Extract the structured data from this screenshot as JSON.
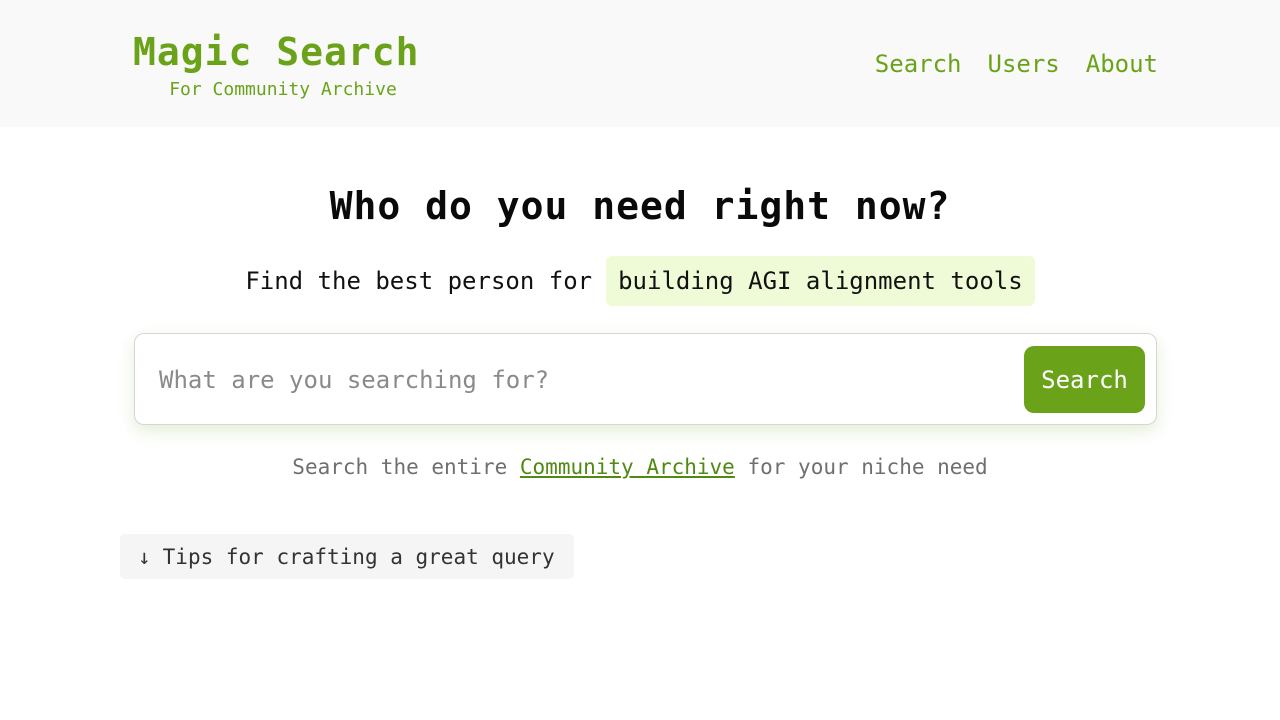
{
  "header": {
    "title": "Magic Search",
    "subtitle": "For Community Archive",
    "nav": [
      {
        "label": "Search"
      },
      {
        "label": "Users"
      },
      {
        "label": "About"
      }
    ]
  },
  "main": {
    "headline": "Who do you need right now?",
    "find_label": "Find the best person for",
    "find_topic": "building AGI alignment tools",
    "search": {
      "placeholder": "What are you searching for?",
      "value": "",
      "button_label": "Search"
    },
    "helper": {
      "prefix": "Search the entire",
      "link": "Community Archive",
      "suffix": "for your niche need"
    },
    "tips": {
      "icon": "arrow-down-icon",
      "label": "Tips for crafting a great query"
    }
  },
  "colors": {
    "accent": "#6aa31a",
    "topic_highlight": "#eefbd6",
    "header_bg": "#f9f9f9"
  }
}
